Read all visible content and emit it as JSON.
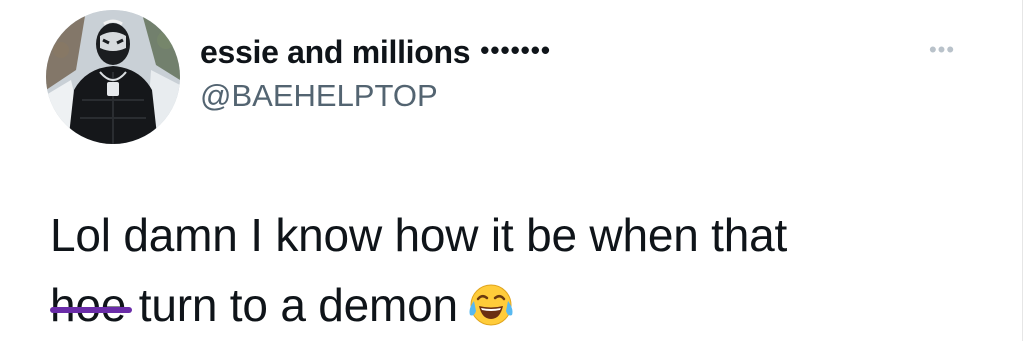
{
  "tweet": {
    "author": {
      "display_name": "essie and millions",
      "name_suffix": "•••••••",
      "handle": "@BAEHELPTOP",
      "avatar": "profile photo: person in black puffer vest and ski mask, snowy trees background"
    },
    "more_icon": "more-horizontal-icon",
    "more_label": "•••",
    "text_line1": "Lol damn I know how it be when that",
    "struck_word": "hoe",
    "text_line2_rest": " turn to a demon",
    "emoji": "face-with-tears-of-joy-icon",
    "colors": {
      "strike": "#6a2ca8",
      "handle": "#536471",
      "text": "#0f1419",
      "more_icon": "#b9c2ca"
    }
  }
}
